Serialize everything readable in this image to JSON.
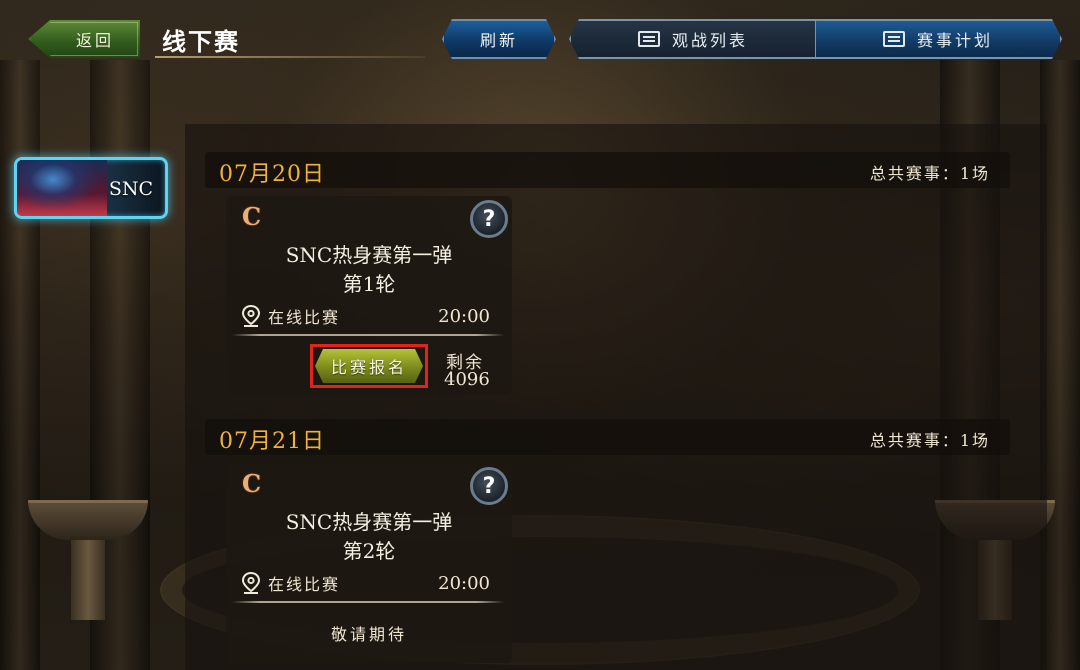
{
  "header": {
    "back_label": "返回",
    "title": "线下赛",
    "refresh_label": "刷新",
    "tabs": [
      {
        "label": "观战列表",
        "icon": "monitor-icon",
        "active": false
      },
      {
        "label": "赛事计划",
        "icon": "monitor-icon",
        "active": true
      }
    ]
  },
  "sidebar": {
    "categories": [
      {
        "label": "SNC",
        "selected": true
      }
    ]
  },
  "days": [
    {
      "date": "07月20日",
      "total": "总共赛事：1场",
      "match": {
        "grade": "C",
        "name": "SNC热身赛第一弹",
        "round": "第1轮",
        "location": "在线比赛",
        "time": "20:00",
        "action_label": "比赛报名",
        "remaining_label": "剩余",
        "remaining_count": "4096"
      }
    },
    {
      "date": "07月21日",
      "total": "总共赛事：1场",
      "match": {
        "grade": "C",
        "name": "SNC热身赛第一弹",
        "round": "第2轮",
        "location": "在线比赛",
        "time": "20:00",
        "status": "敬请期待"
      }
    }
  ],
  "colors": {
    "date_gold": "#f0b23a",
    "grade_copper": "#e7b07a",
    "signup_green": "#7c8a1c",
    "highlight_red": "#e0241a",
    "tab_blue": "#1f5a93",
    "category_cyan": "#5fd4f0"
  }
}
